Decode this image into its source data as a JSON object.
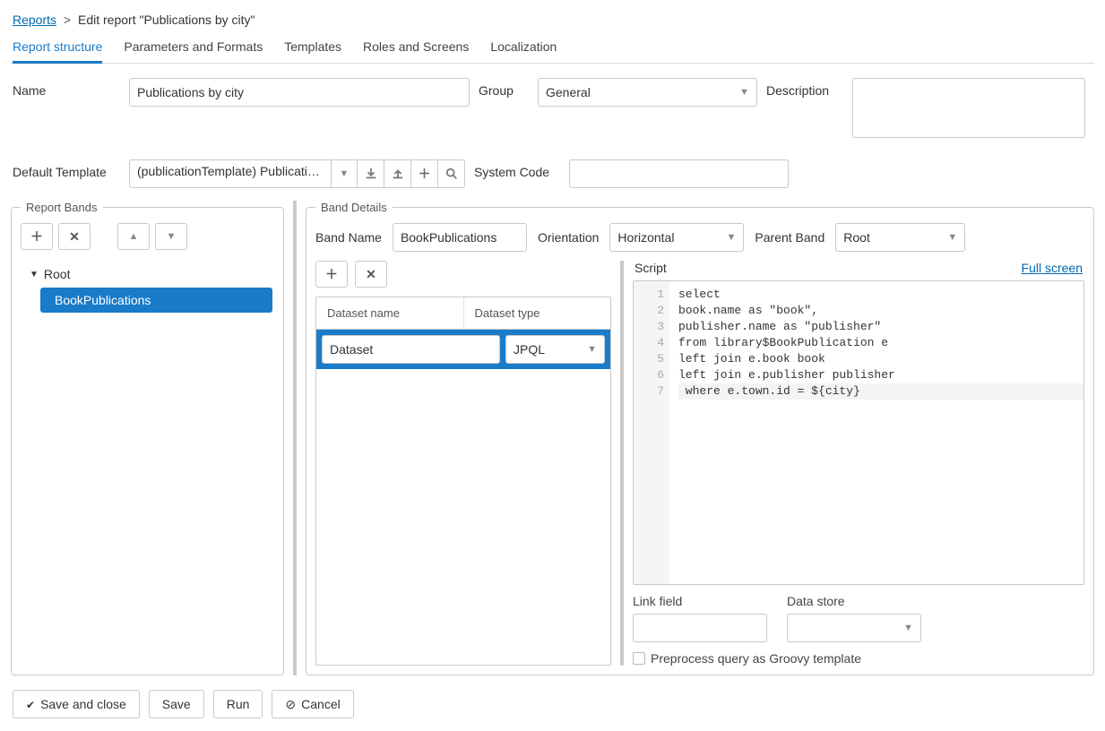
{
  "breadcrumb": {
    "root": "Reports",
    "current": "Edit report \"Publications by city\""
  },
  "tabs": [
    "Report structure",
    "Parameters and Formats",
    "Templates",
    "Roles and Screens",
    "Localization"
  ],
  "activeTab": 0,
  "form": {
    "name_label": "Name",
    "name_value": "Publications by city",
    "group_label": "Group",
    "group_value": "General",
    "description_label": "Description",
    "deftpl_label": "Default Template",
    "deftpl_value": "(publicationTemplate) Publications by city",
    "syscode_label": "System Code"
  },
  "reportBands": {
    "legend": "Report Bands",
    "root_label": "Root",
    "child_label": "BookPublications"
  },
  "bandDetails": {
    "legend": "Band Details",
    "bandName_label": "Band Name",
    "bandName_value": "BookPublications",
    "orientation_label": "Orientation",
    "orientation_value": "Horizontal",
    "parent_label": "Parent Band",
    "parent_value": "Root",
    "ds_name_header": "Dataset name",
    "ds_type_header": "Dataset type",
    "ds_name_value": "Dataset",
    "ds_type_value": "JPQL",
    "script_label": "Script",
    "fullscreen_label": "Full screen",
    "script_lines": [
      "select",
      "book.name as \"book\",",
      "publisher.name as \"publisher\"",
      "from library$BookPublication e",
      "left join e.book book",
      "left join e.publisher publisher",
      " where e.town.id = ${city}"
    ],
    "linkfield_label": "Link field",
    "datastore_label": "Data store",
    "preprocess_label": "Preprocess query as Groovy template"
  },
  "actions": {
    "saveclose": "Save and close",
    "save": "Save",
    "run": "Run",
    "cancel": "Cancel"
  }
}
